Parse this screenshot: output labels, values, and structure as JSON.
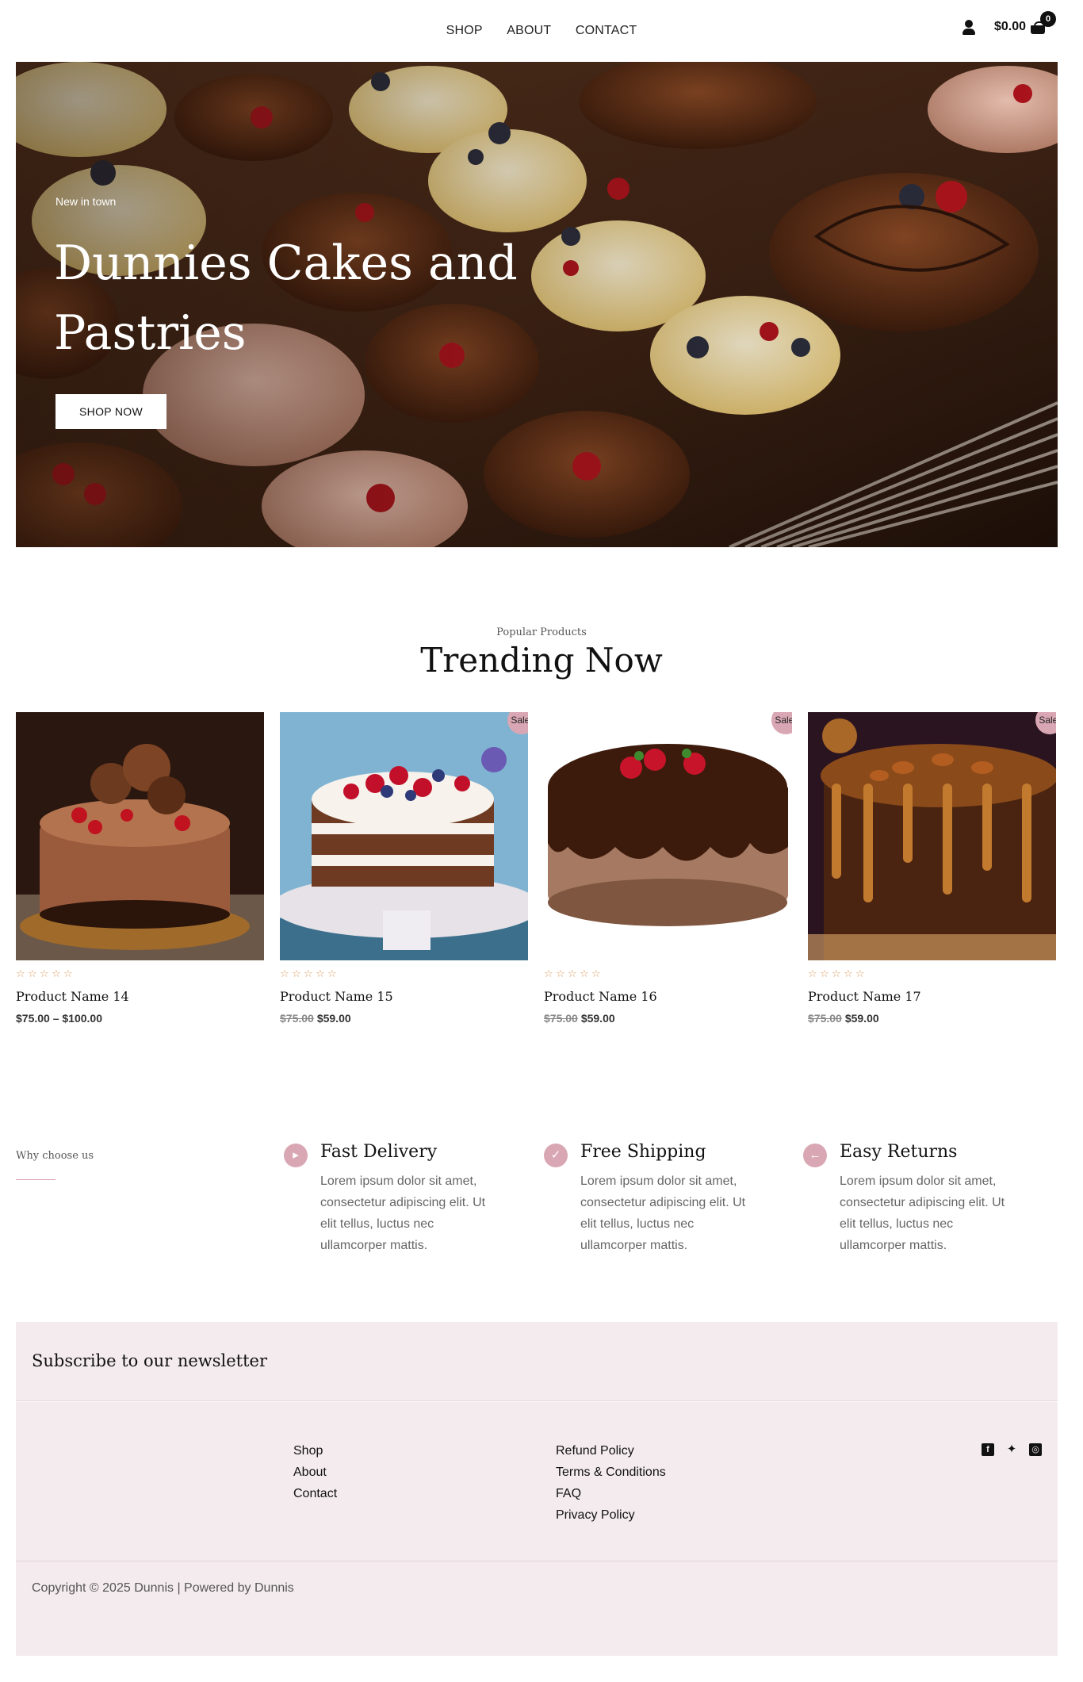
{
  "header": {
    "nav": [
      "SHOP",
      "ABOUT",
      "CONTACT"
    ],
    "cart_total": "$0.00",
    "cart_count": "0",
    "icons": {
      "account": "user-icon",
      "cart": "shopping-bag-icon"
    }
  },
  "hero": {
    "kicker": "New in town",
    "title": "Dunnies Cakes and Pastries",
    "button": "SHOP NOW"
  },
  "trending": {
    "kicker": "Popular Products",
    "title": "Trending Now",
    "products": [
      {
        "name": "Product Name 14",
        "price_text": "$75.00 – $100.00",
        "old_price": "",
        "new_price": "",
        "sale": "",
        "rating": 0
      },
      {
        "name": "Product Name 15",
        "price_text": "",
        "old_price": "$75.00",
        "new_price": "$59.00",
        "sale": "Sale!",
        "rating": 0
      },
      {
        "name": "Product Name 16",
        "price_text": "",
        "old_price": "$75.00",
        "new_price": "$59.00",
        "sale": "Sale!",
        "rating": 0
      },
      {
        "name": "Product Name 17",
        "price_text": "",
        "old_price": "$75.00",
        "new_price": "$59.00",
        "sale": "Sale!",
        "rating": 0
      }
    ]
  },
  "why": {
    "label": "Why choose us",
    "features": [
      {
        "title": "Fast Delivery",
        "text": "Lorem ipsum dolor sit amet, consectetur adipiscing elit. Ut elit tellus, luctus nec ullamcorper mattis.",
        "icon": "truck-icon"
      },
      {
        "title": "Free Shipping",
        "text": "Lorem ipsum dolor sit amet, consectetur adipiscing elit. Ut elit tellus, luctus nec ullamcorper mattis.",
        "icon": "cart-icon"
      },
      {
        "title": "Easy Returns",
        "text": "Lorem ipsum dolor sit amet, consectetur adipiscing elit. Ut elit tellus, luctus nec ullamcorper mattis.",
        "icon": "arrow-left-icon"
      }
    ]
  },
  "footer": {
    "newsletter_title": "Subscribe to our newsletter",
    "col1": [
      "Shop",
      "About",
      "Contact"
    ],
    "col2": [
      "Refund Policy",
      "Terms & Conditions",
      "FAQ",
      "Privacy Policy"
    ],
    "social": [
      "facebook-icon",
      "twitter-icon",
      "instagram-icon"
    ],
    "copyright": "Copyright © 2025 Dunnis | Powered by Dunnis"
  },
  "colors": {
    "accent": "#d9a7b3",
    "footer_bg": "#f4ebee",
    "star": "#e0a063"
  }
}
